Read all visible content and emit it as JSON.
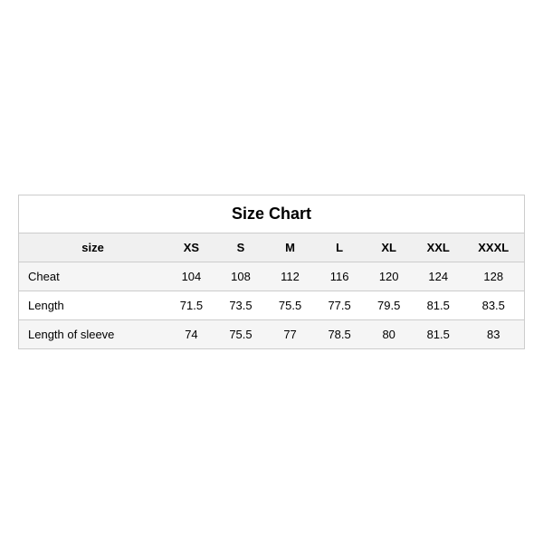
{
  "table": {
    "title": "Size Chart",
    "headers": [
      "size",
      "XS",
      "S",
      "M",
      "L",
      "XL",
      "XXL",
      "XXXL"
    ],
    "rows": [
      {
        "label": "Cheat",
        "values": [
          "104",
          "108",
          "112",
          "116",
          "120",
          "124",
          "128"
        ],
        "shaded": true
      },
      {
        "label": "Length",
        "values": [
          "71.5",
          "73.5",
          "75.5",
          "77.5",
          "79.5",
          "81.5",
          "83.5"
        ],
        "shaded": false
      },
      {
        "label": "Length of sleeve",
        "values": [
          "74",
          "75.5",
          "77",
          "78.5",
          "80",
          "81.5",
          "83"
        ],
        "shaded": true
      }
    ]
  }
}
